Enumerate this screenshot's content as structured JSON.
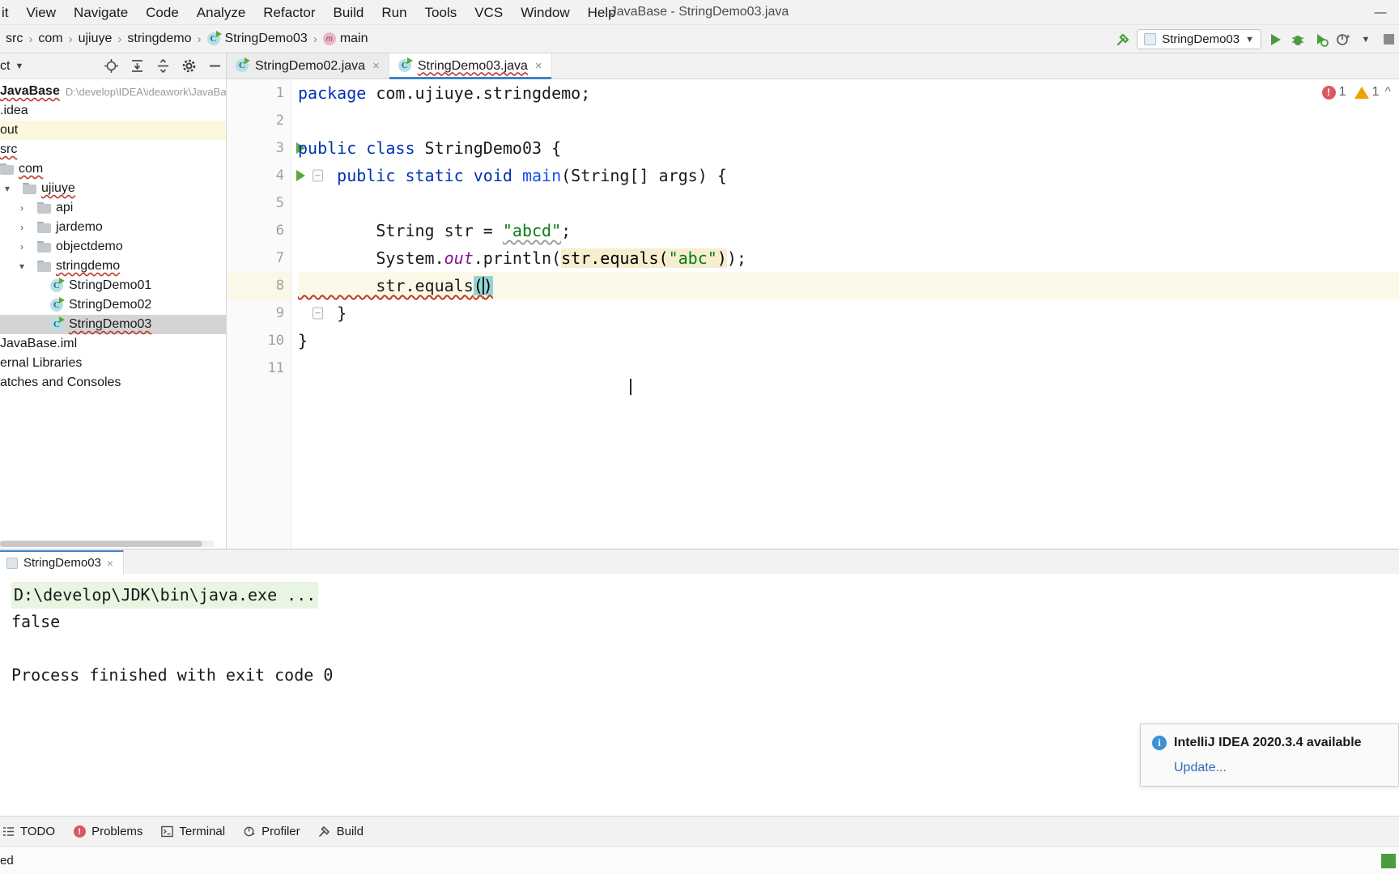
{
  "window": {
    "title": "JavaBase - StringDemo03.java",
    "minimize_label": "—"
  },
  "menu": {
    "items": [
      {
        "label": "it",
        "mnemonic": ""
      },
      {
        "label": "View",
        "mnemonic": "V"
      },
      {
        "label": "Navigate",
        "mnemonic": "N"
      },
      {
        "label": "Code",
        "mnemonic": "C"
      },
      {
        "label": "Analyze",
        "mnemonic": "z"
      },
      {
        "label": "Refactor",
        "mnemonic": "R"
      },
      {
        "label": "Build",
        "mnemonic": "B"
      },
      {
        "label": "Run",
        "mnemonic": "u"
      },
      {
        "label": "Tools",
        "mnemonic": "T"
      },
      {
        "label": "VCS",
        "mnemonic": ""
      },
      {
        "label": "Window",
        "mnemonic": "W"
      },
      {
        "label": "Help",
        "mnemonic": "H"
      }
    ]
  },
  "navbar": {
    "crumbs": [
      {
        "label": "src",
        "icon": "none"
      },
      {
        "label": "com",
        "icon": "none"
      },
      {
        "label": "ujiuye",
        "icon": "none"
      },
      {
        "label": "stringdemo",
        "icon": "none"
      },
      {
        "label": "StringDemo03",
        "icon": "class-icon"
      },
      {
        "label": "main",
        "icon": "method-icon"
      }
    ],
    "separator": "›",
    "run_config": "StringDemo03",
    "run_config_caret": "▼",
    "icons": [
      "build-hammer-icon",
      "run-icon",
      "debug-icon",
      "coverage-icon",
      "profile-icon",
      "more-icon",
      "stop-icon"
    ]
  },
  "project_panel": {
    "title": "ct",
    "title_caret": "▼",
    "toolbar_icons": [
      "locate-icon",
      "expand-all-icon",
      "collapse-all-icon",
      "settings-gear-icon",
      "hide-icon"
    ],
    "tree": [
      {
        "label": "JavaBase",
        "path": "D:\\develop\\IDEA\\ideawork\\JavaBas",
        "indent": 0,
        "icon": "none",
        "bold": true,
        "state": "normal"
      },
      {
        "label": ".idea",
        "indent": 0,
        "icon": "none",
        "state": "normal"
      },
      {
        "label": "out",
        "indent": 0,
        "icon": "none",
        "state": "highlight"
      },
      {
        "label": "src",
        "indent": 0,
        "icon": "none",
        "state": "normal"
      },
      {
        "label": "com",
        "indent": 0,
        "icon": "folder-icon",
        "state": "normal"
      },
      {
        "label": "ujiuye",
        "indent": 1,
        "icon": "folder-icon",
        "twist": "∨",
        "state": "normal"
      },
      {
        "label": "api",
        "indent": 2,
        "icon": "folder-icon",
        "twist": "›",
        "state": "normal"
      },
      {
        "label": "jardemo",
        "indent": 2,
        "icon": "folder-icon",
        "twist": "›",
        "state": "normal"
      },
      {
        "label": "objectdemo",
        "indent": 2,
        "icon": "folder-icon",
        "twist": "›",
        "state": "normal"
      },
      {
        "label": "stringdemo",
        "indent": 2,
        "icon": "folder-icon",
        "twist": "∨",
        "state": "normal"
      },
      {
        "label": "StringDemo01",
        "indent": 3,
        "icon": "class-icon",
        "state": "normal"
      },
      {
        "label": "StringDemo02",
        "indent": 3,
        "icon": "class-icon",
        "state": "normal"
      },
      {
        "label": "StringDemo03",
        "indent": 3,
        "icon": "class-icon",
        "state": "selected"
      },
      {
        "label": "JavaBase.iml",
        "indent": 0,
        "icon": "none",
        "state": "normal"
      },
      {
        "label": "ernal Libraries",
        "indent": 0,
        "icon": "none",
        "state": "normal"
      },
      {
        "label": "atches and Consoles",
        "indent": 0,
        "icon": "none",
        "state": "normal"
      }
    ]
  },
  "editor": {
    "tabs": [
      {
        "label": "StringDemo02.java",
        "active": false,
        "close": "×"
      },
      {
        "label": "StringDemo03.java",
        "active": true,
        "close": "×"
      }
    ],
    "line_numbers": [
      "1",
      "2",
      "3",
      "4",
      "5",
      "6",
      "7",
      "8",
      "9",
      "10",
      "11"
    ],
    "current_line": 8,
    "run_markers": [
      3,
      4
    ],
    "fold_marker_line": 4,
    "code_lines": [
      {
        "n": 1,
        "tokens": [
          {
            "t": "package ",
            "c": "kw"
          },
          {
            "t": "com.ujiuye.stringdemo;",
            "c": "pl"
          }
        ]
      },
      {
        "n": 2,
        "tokens": []
      },
      {
        "n": 3,
        "tokens": [
          {
            "t": "public class ",
            "c": "kw"
          },
          {
            "t": "StringDemo03 {",
            "c": "cls"
          }
        ]
      },
      {
        "n": 4,
        "tokens": [
          {
            "t": "    ",
            "c": "pl"
          },
          {
            "t": "public static void ",
            "c": "kw"
          },
          {
            "t": "main",
            "c": "mth"
          },
          {
            "t": "(String[] args) {",
            "c": "pl"
          }
        ]
      },
      {
        "n": 5,
        "tokens": []
      },
      {
        "n": 6,
        "tokens": [
          {
            "t": "        String str = ",
            "c": "pl"
          },
          {
            "t": "\"abcd\"",
            "c": "str"
          },
          {
            "t": ";",
            "c": "pl"
          }
        ]
      },
      {
        "n": 7,
        "tokens": [
          {
            "t": "        System.",
            "c": "pl"
          },
          {
            "t": "out",
            "c": "fld"
          },
          {
            "t": ".println(",
            "c": "pl"
          },
          {
            "t": "str.equals(",
            "c": "usage"
          },
          {
            "t": "\"abc\"",
            "c": "usage str"
          },
          {
            "t": ")",
            "c": "usage"
          },
          {
            "t": ");",
            "c": "pl"
          }
        ]
      },
      {
        "n": 8,
        "tokens": [
          {
            "t": "        str.equals",
            "c": "pl"
          },
          {
            "t": "()",
            "c": "brk"
          }
        ]
      },
      {
        "n": 9,
        "tokens": [
          {
            "t": "    }",
            "c": "pl"
          }
        ]
      },
      {
        "n": 10,
        "tokens": [
          {
            "t": "}",
            "c": "pl"
          }
        ]
      },
      {
        "n": 11,
        "tokens": []
      }
    ],
    "inspection": {
      "error_count": "1",
      "warning_count": "1",
      "error_icon": "error-badge",
      "warning_icon": "warning-badge"
    }
  },
  "console": {
    "tab_label": "StringDemo03",
    "tab_close": "×",
    "lines": [
      {
        "text": "D:\\develop\\JDK\\bin\\java.exe ...",
        "style": "command"
      },
      {
        "text": "false",
        "style": "plain"
      },
      {
        "text": "",
        "style": "plain"
      },
      {
        "text": "Process finished with exit code 0",
        "style": "plain"
      }
    ]
  },
  "notification": {
    "icon": "info-icon",
    "title": "IntelliJ IDEA 2020.3.4 available",
    "link": "Update..."
  },
  "statusbar": {
    "items": [
      {
        "label": "TODO",
        "icon": "todo-icon"
      },
      {
        "label": "Problems",
        "icon": "problems-icon"
      },
      {
        "label": "Terminal",
        "icon": "terminal-icon"
      },
      {
        "label": "Profiler",
        "icon": "profiler-icon"
      },
      {
        "label": "Build",
        "icon": "build-icon"
      }
    ],
    "status_text": "ed"
  },
  "colors": {
    "accent_blue": "#4083c9",
    "keyword": "#0033b3",
    "string": "#067d17",
    "field": "#871094",
    "method": "#1750eb",
    "run_green": "#59a83c",
    "error_red": "#db5860",
    "warn_orange": "#eda200",
    "selection_gray": "#d4d4d4",
    "highlight_yellow": "#fcf8df",
    "usage_tan": "#f6eecf",
    "bracket_teal": "#93d5d5",
    "console_cmd_green": "#e7f5e2"
  }
}
